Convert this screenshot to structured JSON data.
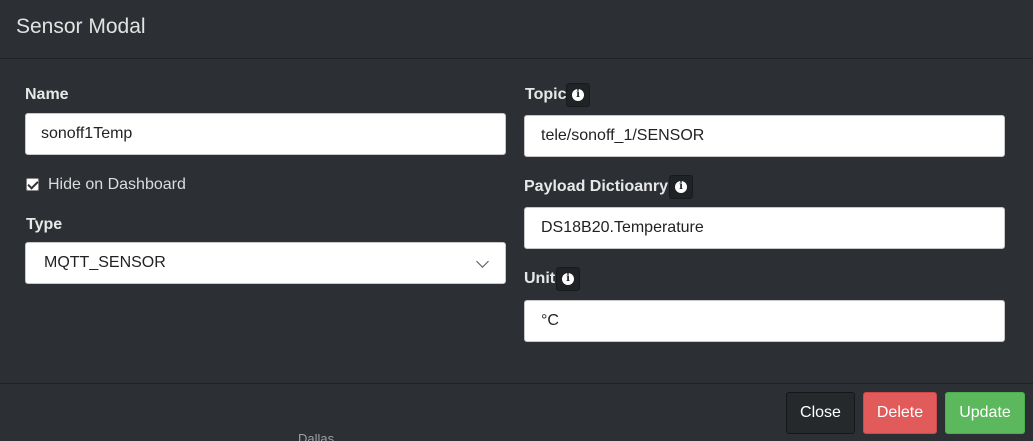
{
  "header": {
    "title": "Sensor Modal"
  },
  "form": {
    "name": {
      "label": "Name",
      "value": "sonoff1Temp"
    },
    "hide_on_dashboard": {
      "label": "Hide on Dashboard",
      "checked": true
    },
    "type": {
      "label": "Type",
      "value": "MQTT_SENSOR"
    },
    "topic": {
      "label": "Topic",
      "value": "tele/sonoff_1/SENSOR"
    },
    "payload_dictionary": {
      "label": "Payload Dictioanry",
      "value": "DS18B20.Temperature"
    },
    "unit": {
      "label": "Unit",
      "value": "°C"
    }
  },
  "info_glyph": "i",
  "icons": [
    "info-icon",
    "chevron-down-icon",
    "checkmark-icon"
  ],
  "footer": {
    "close_label": "Close",
    "delete_label": "Delete",
    "update_label": "Update"
  },
  "colors": {
    "background": "#2c3034",
    "delete": "#e25b5b",
    "update": "#5cb85c",
    "close": "#25292c"
  },
  "background_peek_text": "Dallas"
}
